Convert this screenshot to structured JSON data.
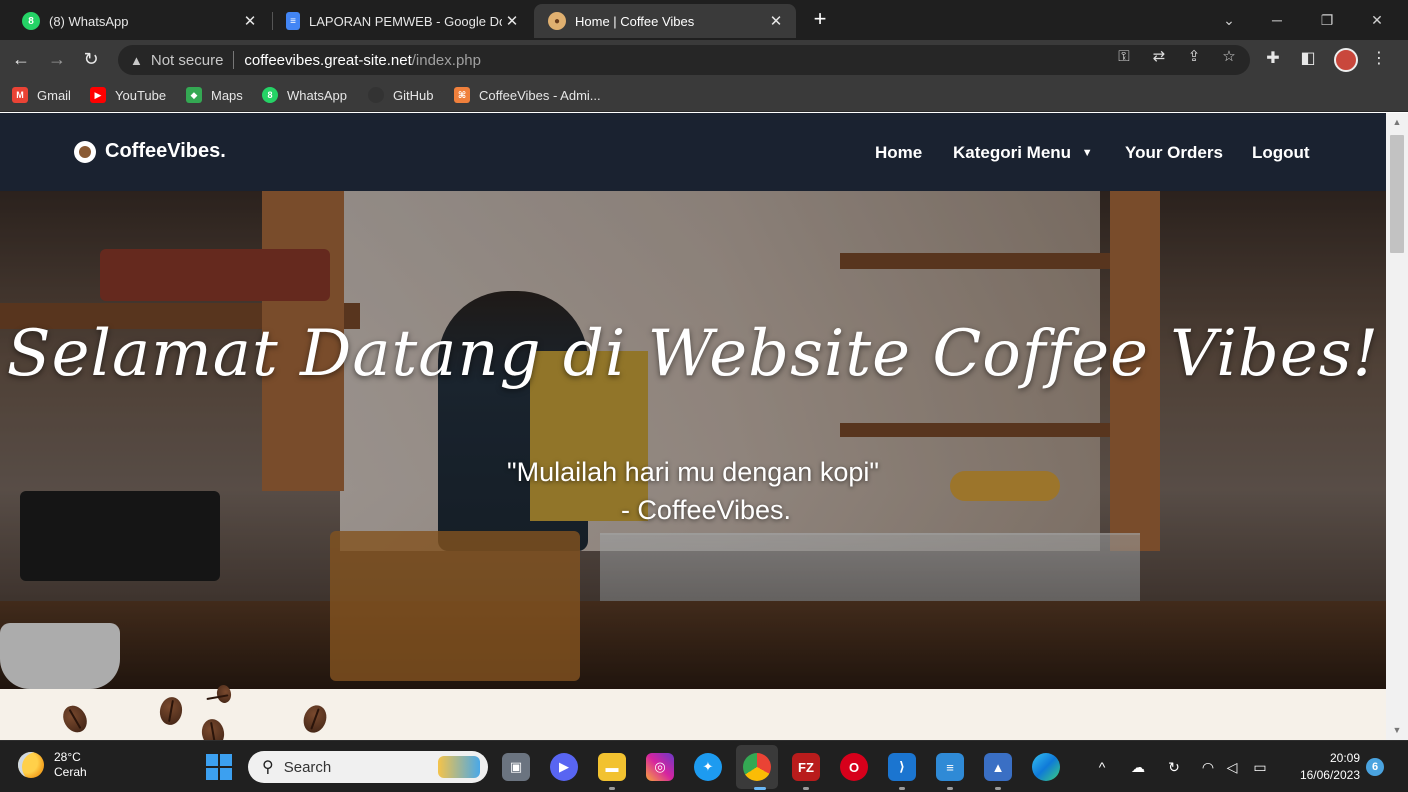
{
  "browser": {
    "tabs": [
      {
        "title": "(8) WhatsApp",
        "favicon": "whatsapp-icon",
        "color": "#25d366"
      },
      {
        "title": "LAPORAN PEMWEB - Google Do",
        "favicon": "google-docs-icon",
        "color": "#4285f4"
      },
      {
        "title": "Home | Coffee Vibes",
        "favicon": "coffee-icon",
        "color": "#e0b070",
        "active": true
      }
    ],
    "new_tab": "+",
    "address": {
      "security": "Not secure",
      "host": "coffeevibes.great-site.net",
      "path": "/index.php"
    },
    "bookmarks": [
      {
        "label": "Gmail",
        "icon": "gmail-icon",
        "color": "#ea4335"
      },
      {
        "label": "YouTube",
        "icon": "youtube-icon",
        "color": "#ff0000"
      },
      {
        "label": "Maps",
        "icon": "maps-icon",
        "color": "#34a853"
      },
      {
        "label": "WhatsApp",
        "icon": "whatsapp-icon",
        "color": "#25d366"
      },
      {
        "label": "GitHub",
        "icon": "github-icon",
        "color": "#333333"
      },
      {
        "label": "CoffeeVibes - Admi...",
        "icon": "admin-icon",
        "color": "#f0803c"
      }
    ]
  },
  "site": {
    "brand": "CoffeeVibes.",
    "nav": {
      "home": "Home",
      "kategori": "Kategori Menu",
      "orders": "Your Orders",
      "logout": "Logout"
    },
    "hero": {
      "title": "Selamat Datang di Website Coffee Vibes!",
      "quote": "\"Mulailah hari mu dengan kopi\"",
      "author": "- CoffeeVibes."
    }
  },
  "taskbar": {
    "weather": {
      "temp": "28°C",
      "condition": "Cerah"
    },
    "search_placeholder": "Search",
    "clock": {
      "time": "20:09",
      "date": "16/06/2023"
    },
    "notifications": "6"
  },
  "colors": {
    "navbar": "#1a2230",
    "page_bg": "#f6f1e9",
    "taskbar": "#202020"
  }
}
